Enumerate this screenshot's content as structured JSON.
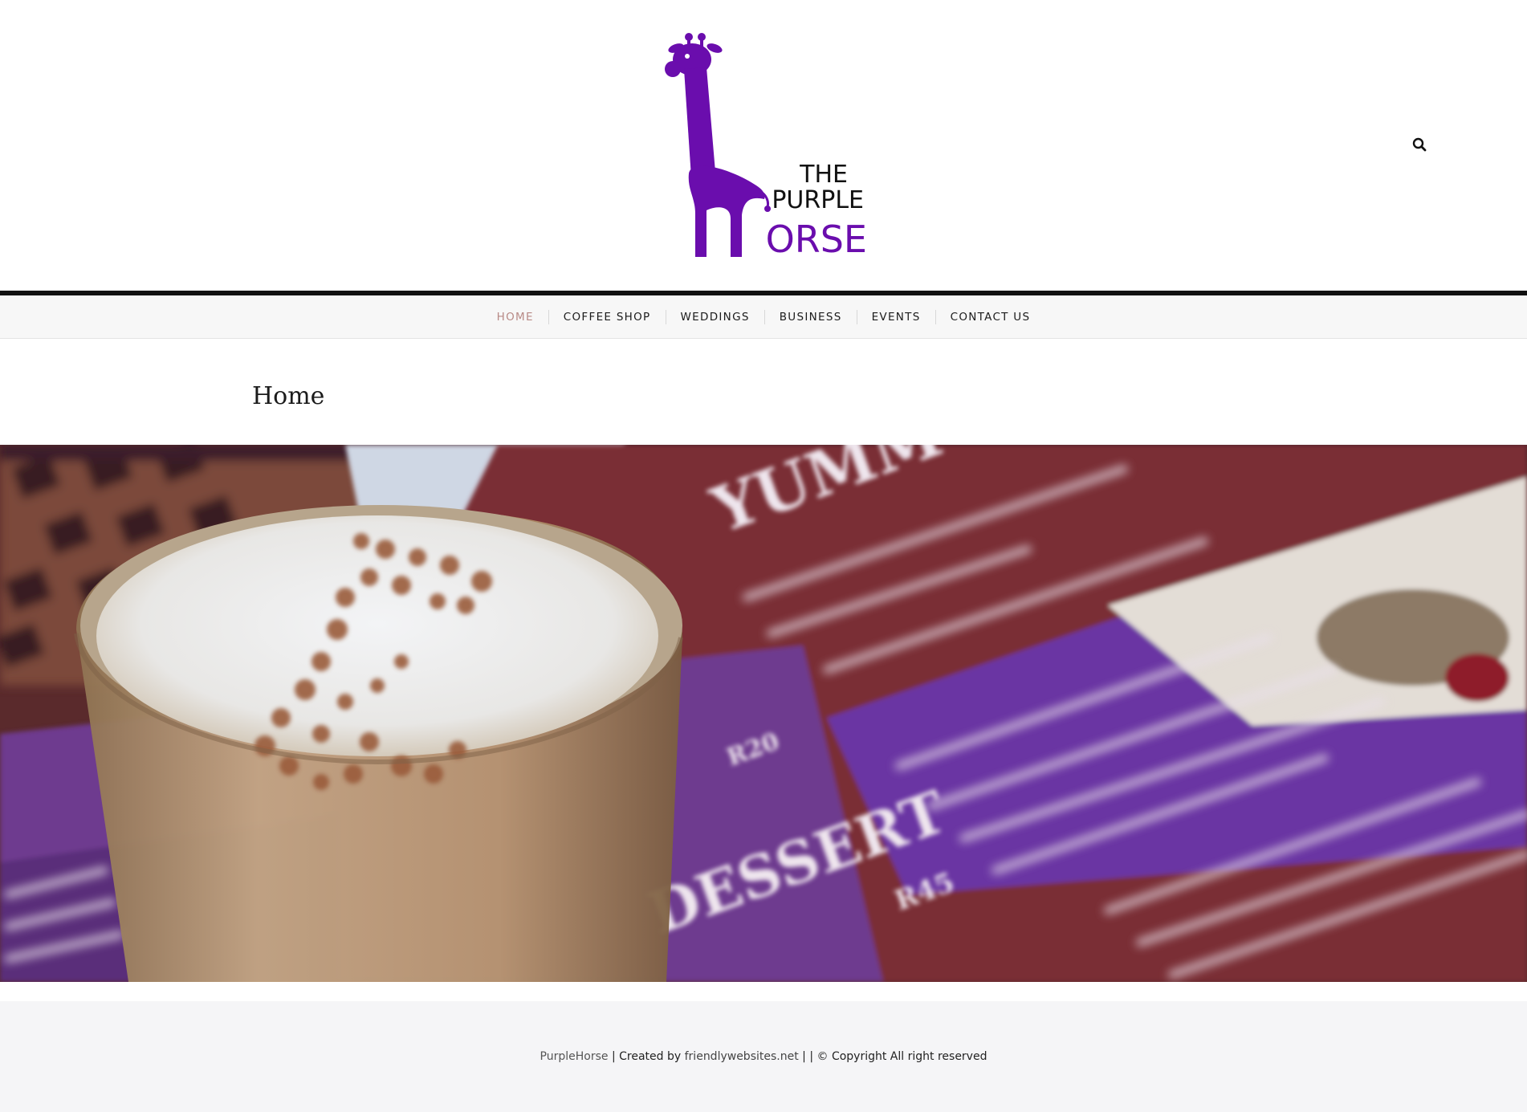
{
  "header": {
    "logo": {
      "line1": "THE",
      "line2": "PURPLE",
      "line3": "ORSE",
      "icon": "giraffe-logo-icon",
      "color": "#6a0dad"
    },
    "search_icon": "search-icon"
  },
  "nav": {
    "items": [
      {
        "label": "HOME",
        "active": true
      },
      {
        "label": "COFFEE SHOP"
      },
      {
        "label": "WEDDINGS"
      },
      {
        "label": "BUSINESS"
      },
      {
        "label": "EVENTS"
      },
      {
        "label": "CONTACT US"
      }
    ],
    "active_color": "#b88a86"
  },
  "main": {
    "page_title": "Home",
    "hero": {
      "menu_heading_1": "YUMM",
      "menu_heading_2": "DESSERT",
      "price_1": "R20",
      "price_2": "R45"
    }
  },
  "footer": {
    "site_name": "PurpleHorse",
    "sep1": " | ",
    "created_by": "Created by ",
    "link": "friendlywebsites.net",
    "sep2": " | | ",
    "copyright": "© Copyright All right reserved"
  },
  "colors": {
    "brand_purple": "#6a0dad",
    "menu_maroon": "#7a2e35",
    "menu_purple": "#6b35a3"
  }
}
